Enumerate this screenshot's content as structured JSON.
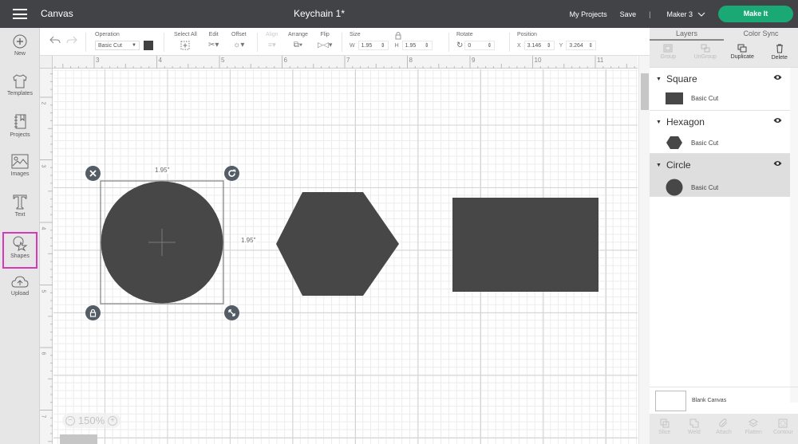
{
  "topbar": {
    "app_title": "Canvas",
    "doc_title": "Keychain 1*",
    "my_projects": "My Projects",
    "save": "Save",
    "divider": "|",
    "machine": "Maker 3",
    "make_it": "Make It"
  },
  "leftbar": {
    "items": [
      {
        "label": "New",
        "icon": "plus-circle-icon"
      },
      {
        "label": "Templates",
        "icon": "shirt-icon"
      },
      {
        "label": "Projects",
        "icon": "notebook-icon"
      },
      {
        "label": "Images",
        "icon": "image-icon"
      },
      {
        "label": "Text",
        "icon": "text-t-icon"
      },
      {
        "label": "Shapes",
        "icon": "shapes-icon"
      },
      {
        "label": "Upload",
        "icon": "cloud-upload-icon"
      }
    ],
    "selected": "Shapes",
    "selected_color": "#d63ab8"
  },
  "toolbar": {
    "operation_label": "Operation",
    "operation_value": "Basic Cut",
    "operation_color": "#414141",
    "select_all": "Select All",
    "edit": "Edit",
    "offset": "Offset",
    "align": "Align",
    "arrange": "Arrange",
    "flip": "Flip",
    "size_label": "Size",
    "w_label": "W",
    "w_value": "1.95",
    "h_label": "H",
    "h_value": "1.95",
    "rotate_label": "Rotate",
    "rotate_value": "0",
    "position_label": "Position",
    "x_label": "X",
    "x_value": "3.146",
    "y_label": "Y",
    "y_value": "3.264"
  },
  "rulers": {
    "top": [
      "3",
      "4",
      "5",
      "6",
      "7",
      "8",
      "9",
      "10",
      "11"
    ],
    "left": [
      "2",
      "3",
      "4",
      "5",
      "6",
      "7"
    ]
  },
  "canvas": {
    "zoom": "150%",
    "zoom_out": "−",
    "zoom_in": "+",
    "shape_color": "#474747",
    "selection": {
      "width_label": "1.95\"",
      "height_label": "1.95\""
    }
  },
  "panel": {
    "tabs": [
      "Layers",
      "Color Sync"
    ],
    "active_tab": "Layers",
    "actions": [
      {
        "label": "Group",
        "enabled": false
      },
      {
        "label": "UnGroup",
        "enabled": false
      },
      {
        "label": "Duplicate",
        "enabled": true
      },
      {
        "label": "Delete",
        "enabled": true
      }
    ],
    "layers": [
      {
        "name": "Square",
        "operation": "Basic Cut",
        "selected": false
      },
      {
        "name": "Hexagon",
        "operation": "Basic Cut",
        "selected": false
      },
      {
        "name": "Circle",
        "operation": "Basic Cut",
        "selected": true
      }
    ],
    "blank_canvas": "Blank Canvas",
    "bottom_actions": [
      "Slice",
      "Weld",
      "Attach",
      "Flatten",
      "Contour"
    ]
  }
}
